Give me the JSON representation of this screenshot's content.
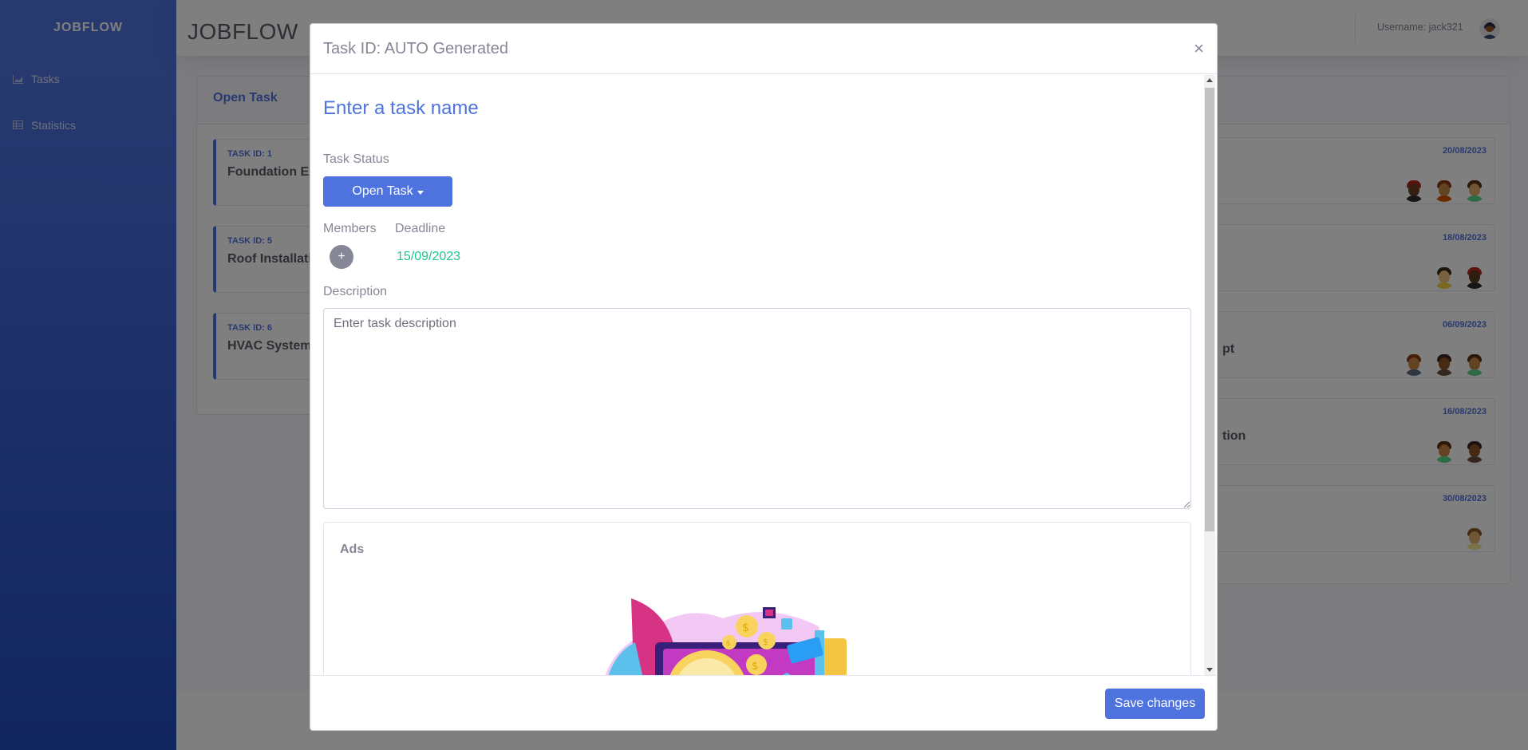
{
  "sidebar": {
    "brand": "JOBFLOW",
    "items": [
      {
        "label": "Tasks",
        "icon": "chart-area-icon"
      },
      {
        "label": "Statistics",
        "icon": "table-icon"
      }
    ]
  },
  "topbar": {
    "title": "JOBFLOW",
    "username": "Username: jack321"
  },
  "open_card": {
    "title": "Open Task",
    "tasks": [
      {
        "id": "TASK ID: 1",
        "name": "Foundation Ex"
      },
      {
        "id": "TASK ID: 5",
        "name": "Roof Installati"
      },
      {
        "id": "TASK ID: 6",
        "name": "HVAC System"
      }
    ]
  },
  "right_card": {
    "tasks": [
      {
        "date": "20/08/2023",
        "name": ""
      },
      {
        "date": "18/08/2023",
        "name": ""
      },
      {
        "date": "06/09/2023",
        "name": "pt"
      },
      {
        "date": "16/08/2023",
        "name": "tion"
      },
      {
        "date": "30/08/2023",
        "name": ""
      }
    ]
  },
  "modal": {
    "title": "Task ID: AUTO Generated",
    "close": "×",
    "task_name": "Enter a task name",
    "status_label": "Task Status",
    "status_value": "Open Task",
    "members_label": "Members",
    "add_member": "+",
    "deadline_label": "Deadline",
    "deadline_value": "15/09/2023",
    "description_label": "Description",
    "description_placeholder": "Enter task description",
    "ads_title": "Ads",
    "save": "Save changes"
  },
  "colors": {
    "primary": "#4e73df",
    "success": "#1cc88a",
    "secondary": "#858796"
  }
}
